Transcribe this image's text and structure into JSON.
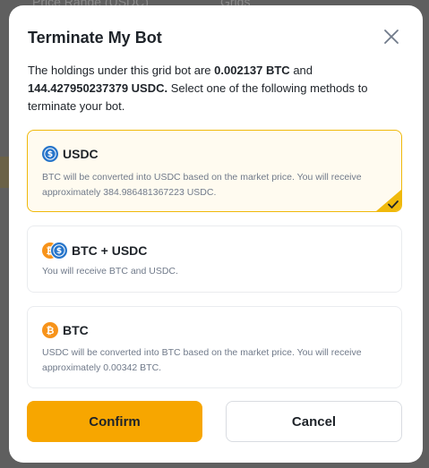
{
  "backdrop": {
    "price_range_label": "Price Range (USDC)",
    "grids_label": "Grids"
  },
  "modal": {
    "title": "Terminate My Bot",
    "description": {
      "prefix": "The holdings under this grid bot are ",
      "btc_amount": "0.002137 BTC",
      "middle": " and ",
      "usdc_amount": "144.427950237379 USDC.",
      "suffix": " Select one of the following methods to terminate your bot."
    },
    "options": [
      {
        "title": "USDC",
        "icon": "usdc-coin-icon",
        "selected": true,
        "text": "BTC will be converted into USDC based on the market price. You will receive approximately 384.986481367223 USDC."
      },
      {
        "title": "BTC + USDC",
        "icon": "btc-usdc-coin-pair-icon",
        "selected": false,
        "text": "You will receive BTC and USDC."
      },
      {
        "title": "BTC",
        "icon": "btc-coin-icon",
        "selected": false,
        "text": "USDC will be converted into BTC based on the market price. You will receive approximately 0.00342 BTC."
      }
    ],
    "confirm_label": "Confirm",
    "cancel_label": "Cancel"
  },
  "colors": {
    "accent": "#f7a600",
    "selected_border": "#f0b90b",
    "selected_bg": "#fffbf0",
    "usdc_blue": "#2775ca",
    "btc_orange": "#f7931a"
  }
}
